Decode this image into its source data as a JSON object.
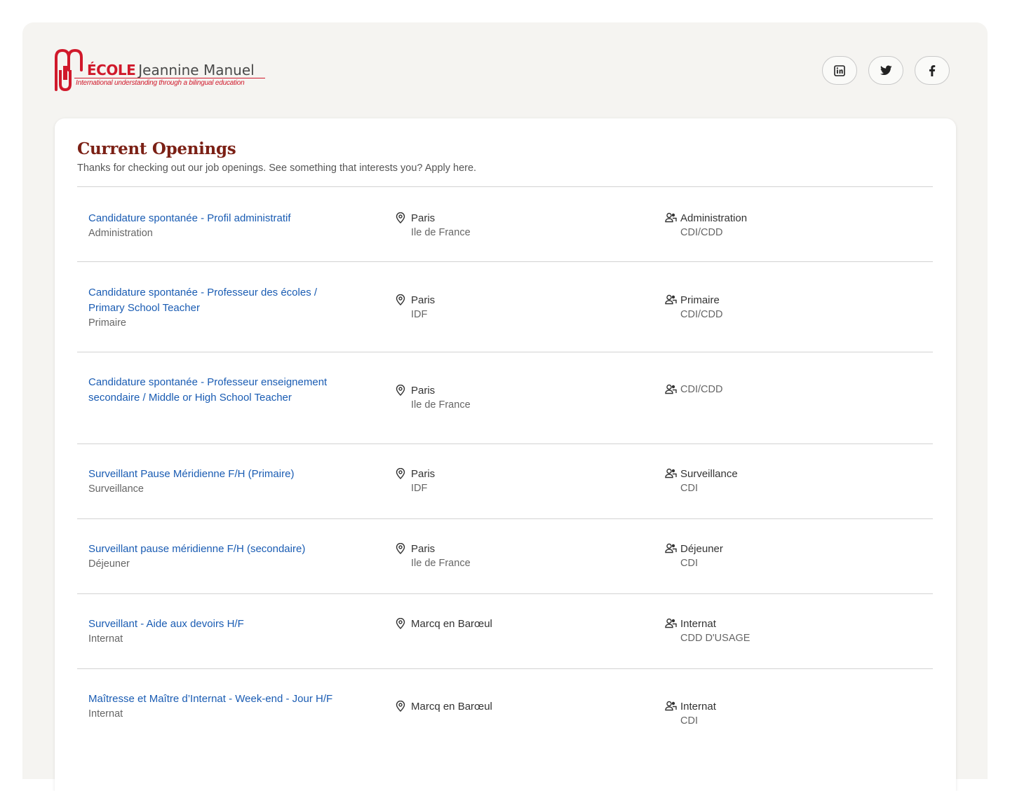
{
  "brand": {
    "logo_ecole": "ÉCOLE",
    "logo_name": "Jeannine Manuel",
    "tagline": "International understanding through a bilingual education",
    "colors": {
      "red": "#d0192b",
      "title": "#7b2015",
      "link": "#1a5cb3"
    }
  },
  "social": [
    {
      "label": "LinkedIn",
      "icon": "linkedin-icon"
    },
    {
      "label": "Twitter",
      "icon": "twitter-icon"
    },
    {
      "label": "Facebook",
      "icon": "facebook-icon"
    }
  ],
  "page": {
    "title": "Current Openings",
    "subtitle": "Thanks for checking out our job openings. See something that interests you? Apply here."
  },
  "jobs": [
    {
      "title": "Candidature spontanée - Profil administratif",
      "department": "Administration",
      "city": "Paris",
      "region": "Ile de France",
      "team": "Administration",
      "contract": "CDI/CDD"
    },
    {
      "title": "Candidature spontanée - Professeur des écoles / Primary School Teacher",
      "department": "Primaire",
      "city": "Paris",
      "region": "IDF",
      "team": "Primaire",
      "contract": "CDI/CDD"
    },
    {
      "title": "Candidature spontanée - Professeur enseignement secondaire / Middle or High School Teacher",
      "department": "",
      "city": "Paris",
      "region": "Ile de France",
      "team": "CDI/CDD",
      "contract": ""
    },
    {
      "title": "Surveillant Pause Méridienne F/H (Primaire)",
      "department": "Surveillance",
      "city": "Paris",
      "region": "IDF",
      "team": "Surveillance",
      "contract": "CDI"
    },
    {
      "title": "Surveillant pause méridienne F/H (secondaire)",
      "department": "Déjeuner",
      "city": "Paris",
      "region": "Ile de France",
      "team": "Déjeuner",
      "contract": "CDI"
    },
    {
      "title": "Surveillant - Aide aux devoirs H/F",
      "department": "Internat",
      "city": "Marcq en Barœul",
      "region": "",
      "team": "Internat",
      "contract": "CDD D'USAGE"
    },
    {
      "title": "Maîtresse et Maître d’Internat - Week-end - Jour H/F",
      "department": "Internat",
      "city": "Marcq en Barœul",
      "region": "",
      "team": "Internat",
      "contract": "CDI"
    }
  ]
}
